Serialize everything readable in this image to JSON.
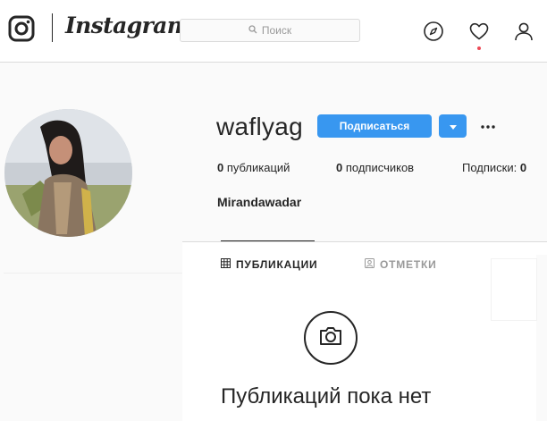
{
  "nav": {
    "logo_text": "Instagram",
    "search_placeholder": "Поиск",
    "icons": [
      "instagram-glyph-icon",
      "explore-compass-icon",
      "heart-icon",
      "profile-icon"
    ]
  },
  "profile": {
    "username": "waflyag",
    "follow_label": "Подписаться",
    "full_name": "Mirandawadar",
    "stats": {
      "posts": {
        "count": "0",
        "label": "публикаций"
      },
      "followers": {
        "count": "0",
        "label": "подписчиков"
      },
      "following": {
        "label": "Подписки:",
        "count": "0"
      }
    }
  },
  "tabs": [
    {
      "label": "ПУБЛИКАЦИИ",
      "icon": "grid-icon",
      "active": true
    },
    {
      "label": "ОТМЕТКИ",
      "icon": "tagged-icon",
      "active": false
    }
  ],
  "empty_state": {
    "icon": "camera-icon",
    "title": "Публикаций пока нет"
  },
  "colors": {
    "accent": "#3897f0",
    "text": "#262626",
    "muted": "#999999",
    "border": "#dbdbdb",
    "notification": "#ed4956"
  }
}
